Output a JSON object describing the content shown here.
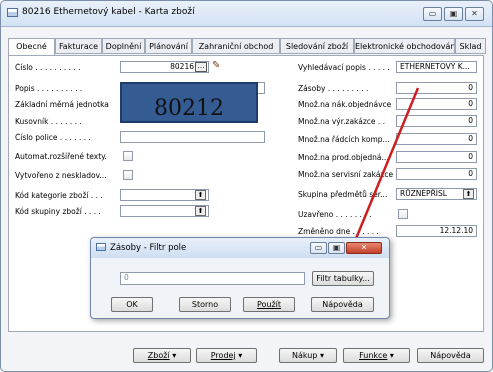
{
  "window": {
    "title": "80216 Ethernetový kabel - Karta zboží"
  },
  "tabs": [
    "Obecné",
    "Fakturace",
    "Doplnění",
    "Plánování",
    "Zahraniční obchod",
    "Sledování zboží",
    "Elektronické obchodování",
    "Sklad"
  ],
  "left_fields": {
    "cislo": {
      "label": "Číslo . . . . . . . . . .",
      "value": "80216"
    },
    "popis": {
      "label": "Popis . . . . . . . . . ."
    },
    "zakladni": {
      "label": "Základní měrná jednotka"
    },
    "kusovnik": {
      "label": "Kusovník . . . . . . ."
    },
    "cislo_police": {
      "label": "Číslo police . . . . . . ."
    },
    "automat": {
      "label": "Automat.rozšířené texty."
    },
    "vytvoreno": {
      "label": "Vytvořeno z neskladov..."
    },
    "kod_kategorie": {
      "label": "Kód kategorie zboží . . ."
    },
    "kod_skupiny": {
      "label": "Kód skupiny zboží . . . ."
    }
  },
  "overlay_number": "80212",
  "right_fields": {
    "vyhledavaci": {
      "label": "Vyhledávací popis . . . . .",
      "value": "ETHERNETOVÝ K..."
    },
    "zasoby": {
      "label": "Zásoby . . . . . . . . .",
      "value": "0"
    },
    "mnoz_nak": {
      "label": "Množ.na nák.objednávce",
      "value": "0"
    },
    "mnoz_vyr": {
      "label": "Množ.na výr.zakázce . .",
      "value": "0"
    },
    "mnoz_radcich": {
      "label": "Množ.na řádcích komp...",
      "value": "0"
    },
    "mnoz_prod": {
      "label": "Množ.na prod.objedná...",
      "value": "0"
    },
    "mnoz_servis": {
      "label": "Množ.na servisní zakázce",
      "value": "0"
    },
    "skupina": {
      "label": "Skupina předmětů ser...",
      "value": "RŮZNÉPŘÍSL"
    },
    "uzavreno": {
      "label": "Uzavřeno . . . . . . . ."
    },
    "zmeneno": {
      "label": "Změněno dne . . . . . .",
      "value": "12.12.10"
    }
  },
  "dialog": {
    "title": "Zásoby - Filtr pole",
    "filter_value": "0",
    "filter_table_button": "Filtr tabulky...",
    "ok": "OK",
    "cancel": "Storno",
    "apply": "Použít",
    "help": "Nápověda"
  },
  "bottom_buttons": {
    "zbozi": "Zboží",
    "prodej": "Prodej",
    "nakup": "Nákup",
    "funkce": "Funkce",
    "napoveda": "Nápověda"
  },
  "colors": {
    "annotation_arrow": "#cc1f1f",
    "overlay_box": "#345c93"
  },
  "icons": [
    "window-icon",
    "minimize-icon",
    "maximize-icon",
    "close-icon",
    "assist-edit-icon",
    "pencil-icon",
    "lookup-arrow-icon",
    "dropdown-arrow-icon"
  ]
}
